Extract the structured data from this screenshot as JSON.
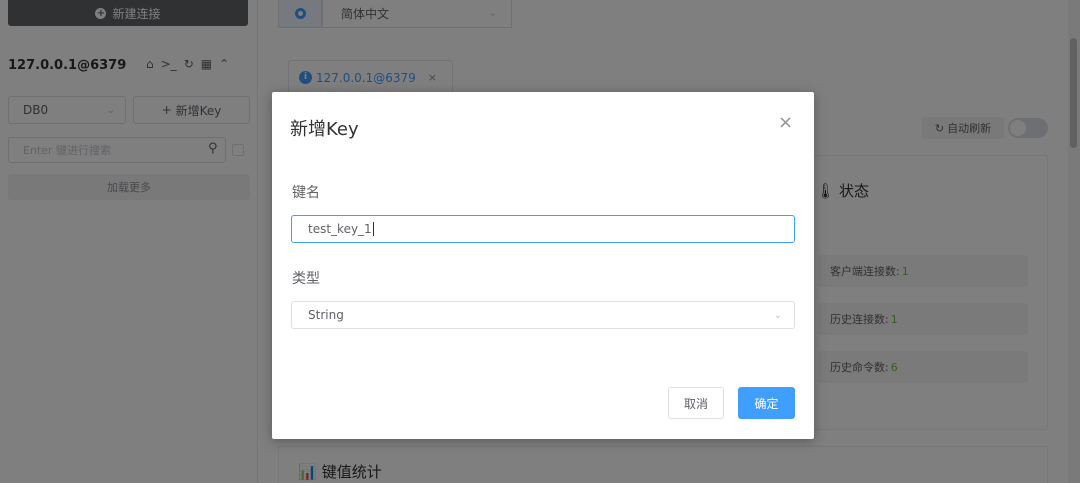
{
  "sidebar": {
    "new_connection_label": "新建连接",
    "connection_title": "127.0.0.1@6379",
    "db_select_value": "DB0",
    "add_key_label": "新增Key",
    "search_placeholder": "Enter 键进行搜索",
    "load_more_label": "加载更多"
  },
  "topbar": {
    "language_value": "简体中文"
  },
  "main": {
    "tab_label": "127.0.0.1@6379",
    "auto_refresh_label": "自动刷新",
    "status_title": "状态",
    "stats": [
      {
        "label": "客户端连接数:",
        "value": "1"
      },
      {
        "label": "历史连接数:",
        "value": "1"
      },
      {
        "label": "历史命令数:",
        "value": "6"
      }
    ],
    "kv_title": "键值统计"
  },
  "dialog": {
    "title": "新增Key",
    "key_name_label": "键名",
    "key_name_value": "test_key_1",
    "type_label": "类型",
    "type_value": "String",
    "cancel_label": "取消",
    "confirm_label": "确定"
  },
  "colors": {
    "accent": "#409eff",
    "success": "#67c23a",
    "overlay": "rgba(0,0,0,0.5)"
  }
}
